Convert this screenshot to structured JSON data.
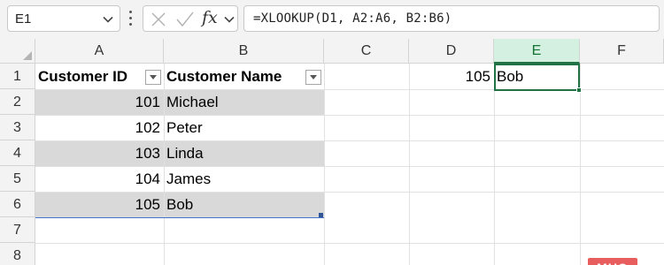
{
  "name_box": {
    "value": "E1"
  },
  "formula_bar": {
    "function_label": "fx",
    "formula": "=XLOOKUP(D1, A2:A6, B2:B6)"
  },
  "columns": [
    "A",
    "B",
    "C",
    "D",
    "E",
    "F"
  ],
  "selected_column": "E",
  "rows": [
    "1",
    "2",
    "3",
    "4",
    "5",
    "6",
    "7",
    "8"
  ],
  "table": {
    "headers": [
      "Customer ID",
      "Customer Name"
    ],
    "records": [
      {
        "id": "101",
        "name": "Michael"
      },
      {
        "id": "102",
        "name": "Peter"
      },
      {
        "id": "103",
        "name": "Linda"
      },
      {
        "id": "104",
        "name": "James"
      },
      {
        "id": "105",
        "name": "Bob"
      }
    ]
  },
  "lookup": {
    "d1": "105",
    "e1": "Bob"
  },
  "watermark": "MUO",
  "colors": {
    "accent_green": "#217346",
    "band_gray": "#d9d9d9",
    "watermark_red": "#e85d5d"
  },
  "icons": {
    "name_box_dropdown": "chevron-down-icon",
    "cancel": "x-icon",
    "enter": "check-icon",
    "formula_dropdown": "chevron-down-icon",
    "filter": "dropdown-arrow-icon"
  }
}
